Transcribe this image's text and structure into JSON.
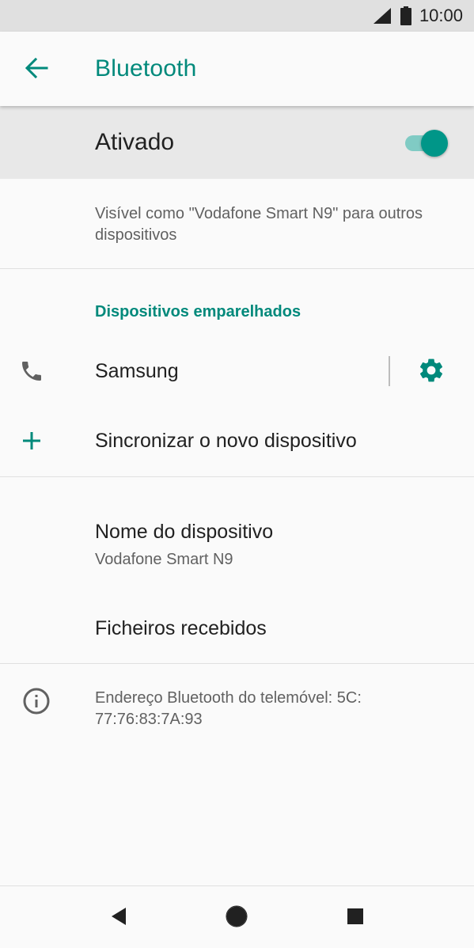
{
  "status_bar": {
    "time": "10:00",
    "icons": [
      "signal-icon",
      "battery-icon"
    ]
  },
  "app_bar": {
    "title": "Bluetooth",
    "back_icon": "arrow-back-icon"
  },
  "master_switch": {
    "label": "Ativado",
    "state": "on"
  },
  "visibility_text": "Visível como \"Vodafone Smart N9\" para outros dispositivos",
  "paired_devices": {
    "header": "Dispositivos emparelhados",
    "items": [
      {
        "name": "Samsung",
        "icon": "phone-icon",
        "settings_icon": "gear-icon"
      }
    ]
  },
  "pair_new": {
    "label": "Sincronizar o novo dispositivo",
    "icon": "plus-icon"
  },
  "device_name": {
    "label": "Nome do dispositivo",
    "value": "Vodafone Smart N9"
  },
  "received_files": {
    "label": "Ficheiros recebidos"
  },
  "info": {
    "icon": "info-icon",
    "text": "Endereço Bluetooth do telemóvel: 5C:\n77:76:83:7A:93"
  },
  "nav_bar": {
    "buttons": [
      "back-triangle-icon",
      "home-circle-icon",
      "recents-square-icon"
    ]
  },
  "colors": {
    "accent": "#00897b",
    "switch_thumb": "#009688",
    "switch_track": "#80cbc4",
    "status_bar_bg": "#e0e0e0",
    "master_row_bg": "#e8e8e8",
    "text_primary": "#212121",
    "text_secondary": "#616161"
  }
}
